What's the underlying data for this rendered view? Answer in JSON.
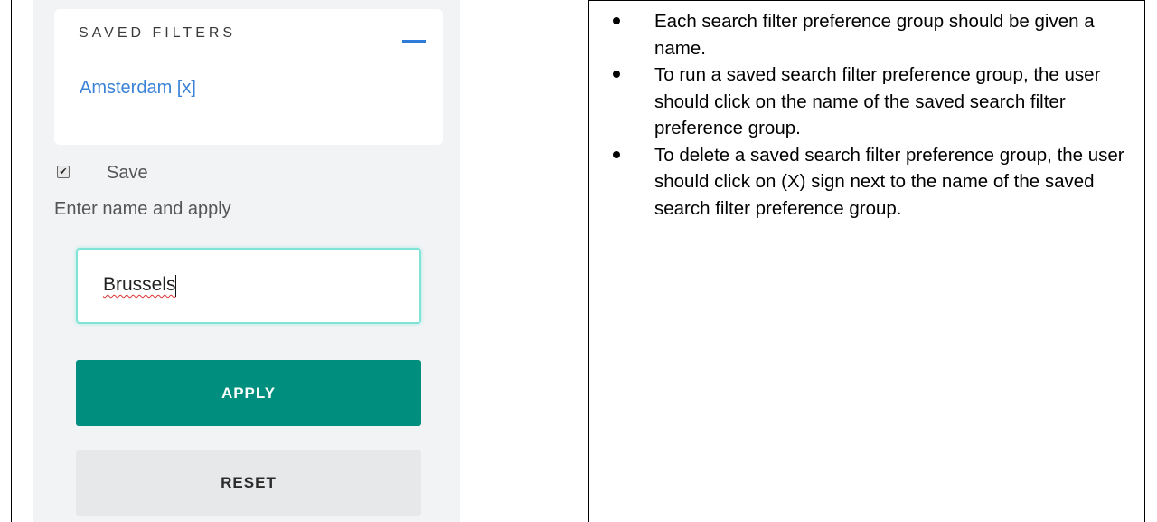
{
  "sidebar": {
    "saved_filters_title": "SAVED FILTERS",
    "collapse_icon": "minus-icon",
    "saved_items": [
      {
        "label": "Amsterdam [x]"
      }
    ],
    "save_checkbox": {
      "checked": true,
      "label": "Save"
    },
    "enter_name_label": "Enter name and apply",
    "name_input": {
      "value": "Brussels"
    },
    "apply_label": "APPLY",
    "reset_label": "RESET",
    "colors": {
      "apply": "#008f7e",
      "link": "#3a83d6",
      "input_focus": "#7fe3d8"
    }
  },
  "notes": {
    "bullets": [
      "Each search filter preference group should be given a name.",
      "To run a saved search filter preference group,  the user should click on the name of the saved search filter preference group.",
      "To delete a saved search filter preference group,  the user should click on (X) sign next to the name of the saved search filter preference group."
    ]
  }
}
